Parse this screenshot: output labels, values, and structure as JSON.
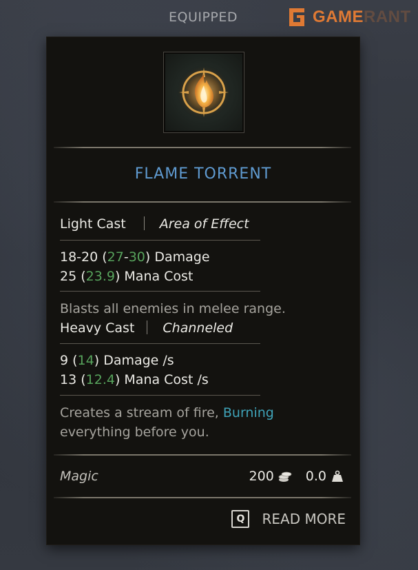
{
  "header": {
    "label": "EQUIPPED"
  },
  "watermark": {
    "bold_text": "GAME",
    "faded_text": "RANT",
    "icon": "gamerant-logo-icon",
    "color": "#e07a34"
  },
  "skill": {
    "icon": "flame-torrent-skill-icon",
    "title": "FLAME TORRENT",
    "title_color": "#5f9ad0",
    "light_cast": {
      "label": "Light Cast",
      "type": "Area of Effect",
      "damage_base": "18-20",
      "damage_bonus_low": "27",
      "damage_bonus_high": "30",
      "damage_suffix": "Damage",
      "mana_base": "25",
      "mana_bonus": "23.9",
      "mana_suffix": "Mana Cost",
      "description": "Blasts all enemies in melee range."
    },
    "heavy_cast": {
      "label": "Heavy Cast",
      "type": "Channeled",
      "damage_base": "9",
      "damage_bonus": "14",
      "damage_suffix": "Damage /s",
      "mana_base": "13",
      "mana_bonus": "12.4",
      "mana_suffix": "Mana Cost /s",
      "description_pre": "Creates a stream of fire,",
      "description_keyword": "Burning",
      "description_post": "everything before you."
    }
  },
  "footer": {
    "category": "Magic",
    "price": "200",
    "price_icon": "coin-stack-icon",
    "weight": "0.0",
    "weight_icon": "weight-icon"
  },
  "read_more": {
    "key": "Q",
    "label": "READ MORE"
  },
  "colors": {
    "bonus_green": "#57a35c",
    "keyword_teal": "#3fa3b8",
    "card_bg": "#13120f"
  }
}
